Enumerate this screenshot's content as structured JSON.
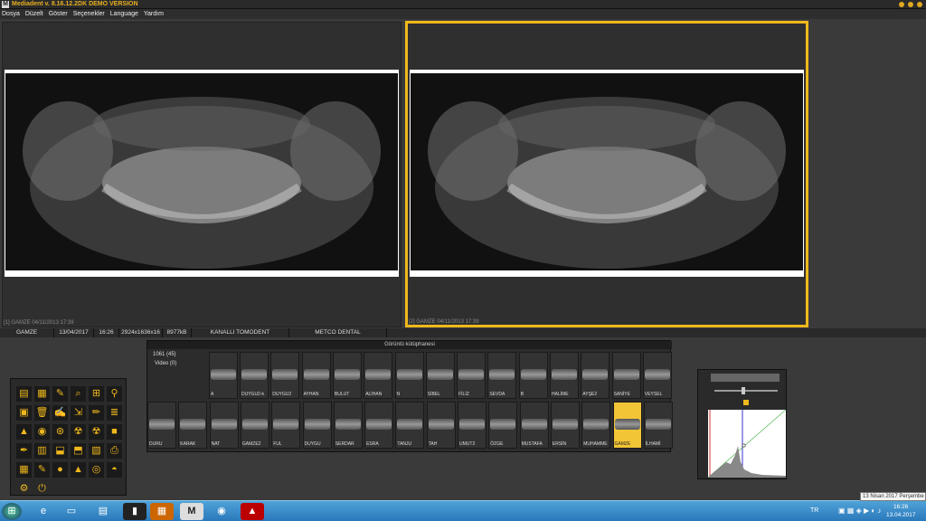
{
  "app": {
    "title": "Mediadent v. 8.16.12.2DK DEMO VERSION",
    "logo": "M"
  },
  "menu": [
    "Dosya",
    "Düzelt",
    "Göster",
    "Seçenekler",
    "Language",
    "Yardım"
  ],
  "panes": {
    "left_caption": "[1] GAMZE 04/11/2013 17:39",
    "right_caption": "[2] GAMZE 04/11/2013 17:39"
  },
  "status": {
    "name": "GAMZE",
    "date": "13/04/2017",
    "time": "16:26",
    "dims": "2924x1636x16",
    "size": "8977kB",
    "device": "KANALLI TOMODENT",
    "vendor": "METCO DENTAL"
  },
  "library": {
    "title": "Görüntü kütüphanesi",
    "count": "1061 (45)",
    "video": "Video (0)",
    "row1": [
      "A",
      "DUYGU2-k",
      "DUYGU2",
      "AYHAN",
      "BULUT",
      "ALİHAN",
      "N",
      "SİBEL",
      "FİLİZ",
      "SEVDA",
      "B",
      "HALİME",
      "AYŞE2",
      "SANİYE",
      "VEYSEL"
    ],
    "row2": [
      "DURU",
      "KARAK",
      "NAT",
      "GAMZE2",
      "FUL",
      "DUYGU",
      "SERDAR",
      "ESRA",
      "TANJU",
      "TAH",
      "UMUT2",
      "ÖZGE",
      "MUSTAFA",
      "ERSİN",
      "MUHAMME",
      "GAMZE",
      "İLHAMİ"
    ],
    "selected": "GAMZE"
  },
  "taskbar": {
    "lang": "TR",
    "time": "16:26",
    "date": "13.04.2017"
  },
  "tooltip": "13 Nisan 2017 Perşembe",
  "colors": {
    "accent": "#f0b81c",
    "taskbar": "#2a78bb"
  }
}
